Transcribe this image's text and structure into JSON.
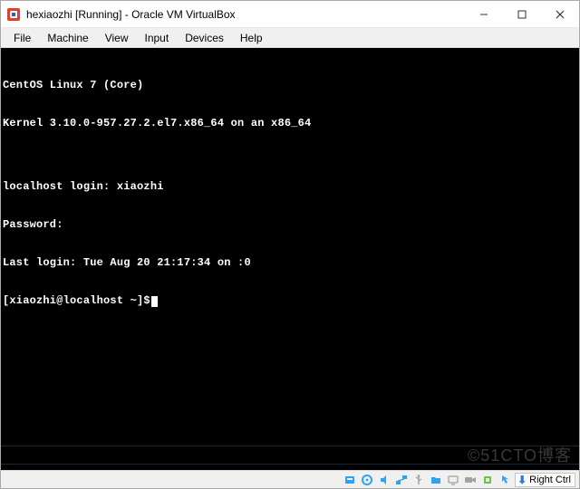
{
  "colors": {
    "accent": "#2b78e4",
    "tray_blue": "#2ea3f2",
    "tray_gray": "#a1a1a1"
  },
  "title": "hexiaozhi  [Running] - Oracle VM VirtualBox",
  "menu": {
    "file": "File",
    "machine": "Machine",
    "view": "View",
    "input": "Input",
    "devices": "Devices",
    "help": "Help"
  },
  "terminal": {
    "line1": "CentOS Linux 7 (Core)",
    "line2": "Kernel 3.10.0-957.27.2.el7.x86_64 on an x86_64",
    "line3": "",
    "line4": "localhost login: xiaozhi",
    "line5": "Password:",
    "line6": "Last login: Tue Aug 20 21:17:34 on :0",
    "line7": "[xiaozhi@localhost ~]$"
  },
  "statusbar": {
    "hostkey": "Right Ctrl",
    "icons": [
      "disk-icon",
      "optical-icon",
      "audio-icon",
      "network-icon",
      "usb-icon",
      "shared-folder-icon",
      "display-icon",
      "recording-icon",
      "cpu-icon",
      "mouse-capture-icon"
    ]
  },
  "watermark": "©51CTO博客"
}
